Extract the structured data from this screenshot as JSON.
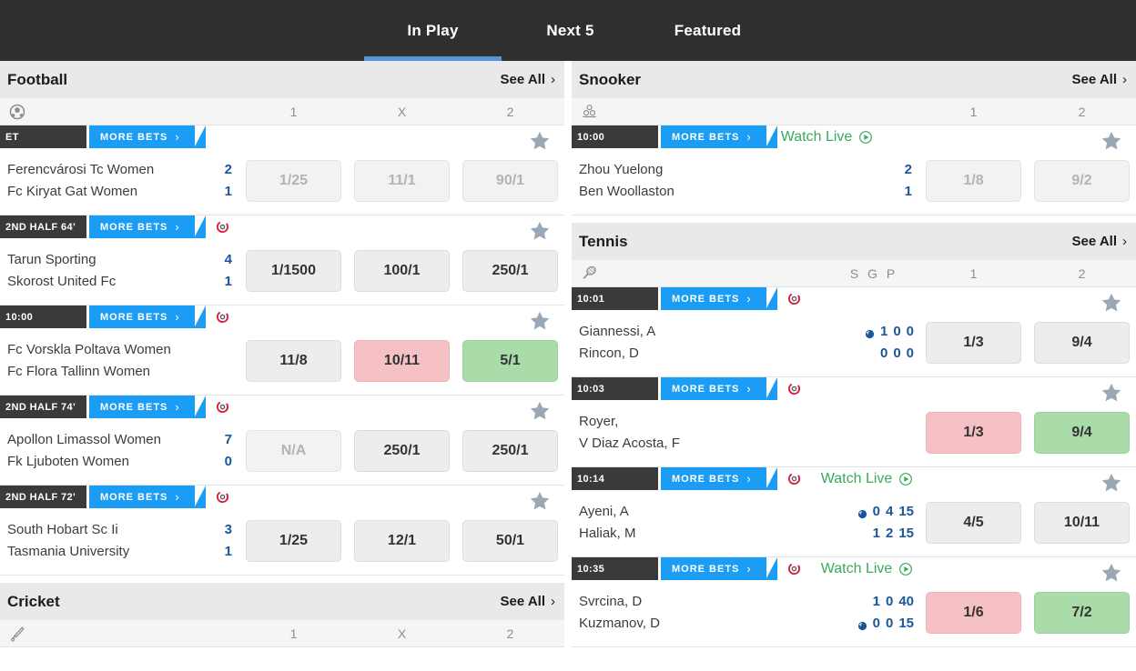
{
  "tabs": [
    {
      "label": "In Play",
      "active": true
    },
    {
      "label": "Next 5",
      "active": false
    },
    {
      "label": "Featured",
      "active": false
    }
  ],
  "labels": {
    "see_all": "See All",
    "chevron": "›",
    "more_bets": "MORE BETS",
    "more_bets_chevron": "›",
    "watch_live": "Watch Live"
  },
  "colors": {
    "accent_blue": "#1b9df5",
    "tab_underline": "#5596d8",
    "topbar_bg": "#2f2f2f",
    "time_chip_bg": "#3a3a3a",
    "score_blue": "#19569b",
    "watch_live_green": "#3aaa5c",
    "odds_up_green": "#aadcaa",
    "odds_down_pink": "#f6c1c5",
    "odds_neutral": "#ededed",
    "star_grey": "#9aa7b4",
    "stats_icon_red": "#d81f3f"
  },
  "left_column": [
    {
      "sport": "Football",
      "sport_icon": "football-icon",
      "columns": [
        "1",
        "X",
        "2"
      ],
      "events": [
        {
          "time": "ET",
          "has_stats": false,
          "watch_live": false,
          "teams": [
            "Ferencvárosi Tc Women",
            "Fc Kiryat Gat Women"
          ],
          "scores": [
            "2",
            "1"
          ],
          "odds": [
            {
              "value": "1/25",
              "state": "dim"
            },
            {
              "value": "11/1",
              "state": "dim"
            },
            {
              "value": "90/1",
              "state": "dim"
            }
          ]
        },
        {
          "time": "2ND HALF 64'",
          "has_stats": true,
          "watch_live": false,
          "teams": [
            "Tarun Sporting",
            "Skorost United Fc"
          ],
          "scores": [
            "4",
            "1"
          ],
          "odds": [
            {
              "value": "1/1500",
              "state": "neutral"
            },
            {
              "value": "100/1",
              "state": "neutral"
            },
            {
              "value": "250/1",
              "state": "neutral"
            }
          ]
        },
        {
          "time": "10:00",
          "has_stats": true,
          "watch_live": false,
          "teams": [
            "Fc Vorskla Poltava Women",
            "Fc Flora Tallinn Women"
          ],
          "scores": [
            "",
            ""
          ],
          "odds": [
            {
              "value": "11/8",
              "state": "neutral"
            },
            {
              "value": "10/11",
              "state": "down"
            },
            {
              "value": "5/1",
              "state": "up"
            }
          ]
        },
        {
          "time": "2ND HALF 74'",
          "has_stats": true,
          "watch_live": false,
          "teams": [
            "Apollon Limassol Women",
            "Fk Ljuboten Women"
          ],
          "scores": [
            "7",
            "0"
          ],
          "odds": [
            {
              "value": "N/A",
              "state": "dim"
            },
            {
              "value": "250/1",
              "state": "neutral"
            },
            {
              "value": "250/1",
              "state": "neutral"
            }
          ]
        },
        {
          "time": "2ND HALF 72'",
          "has_stats": true,
          "watch_live": false,
          "teams": [
            "South Hobart Sc Ii",
            "Tasmania University"
          ],
          "scores": [
            "3",
            "1"
          ],
          "odds": [
            {
              "value": "1/25",
              "state": "neutral"
            },
            {
              "value": "12/1",
              "state": "neutral"
            },
            {
              "value": "50/1",
              "state": "neutral"
            }
          ]
        }
      ]
    },
    {
      "sport": "Cricket",
      "sport_icon": "cricket-bat-icon",
      "columns": [
        "1",
        "X",
        "2"
      ],
      "events": []
    }
  ],
  "right_column": [
    {
      "sport": "Snooker",
      "sport_icon": "snooker-balls-icon",
      "columns": [
        "1",
        "2"
      ],
      "events": [
        {
          "time": "10:00",
          "has_stats": false,
          "watch_live": true,
          "teams": [
            "Zhou Yuelong",
            "Ben Woollaston"
          ],
          "scores": [
            "2",
            "1"
          ],
          "odds": [
            {
              "value": "1/8",
              "state": "dim"
            },
            {
              "value": "9/2",
              "state": "dim"
            }
          ]
        }
      ]
    },
    {
      "sport": "Tennis",
      "sport_icon": "tennis-racket-icon",
      "columns": [
        "S G P",
        "1",
        "2"
      ],
      "events": [
        {
          "time": "10:01",
          "has_stats": true,
          "watch_live": false,
          "teams": [
            "Giannessi, A",
            "Rincon, D"
          ],
          "tennis_scores": [
            {
              "serving": true,
              "values": [
                "1",
                "0",
                "0"
              ]
            },
            {
              "serving": false,
              "values": [
                "0",
                "0",
                "0"
              ]
            }
          ],
          "odds": [
            {
              "value": "1/3",
              "state": "neutral"
            },
            {
              "value": "9/4",
              "state": "neutral"
            }
          ]
        },
        {
          "time": "10:03",
          "has_stats": true,
          "watch_live": false,
          "teams": [
            "Royer,",
            "V Diaz Acosta, F"
          ],
          "tennis_scores": [],
          "odds": [
            {
              "value": "1/3",
              "state": "down"
            },
            {
              "value": "9/4",
              "state": "up"
            }
          ]
        },
        {
          "time": "10:14",
          "has_stats": true,
          "watch_live": true,
          "teams": [
            "Ayeni, A",
            "Haliak, M"
          ],
          "tennis_scores": [
            {
              "serving": true,
              "values": [
                "0",
                "4",
                "15"
              ]
            },
            {
              "serving": false,
              "values": [
                "1",
                "2",
                "15"
              ]
            }
          ],
          "odds": [
            {
              "value": "4/5",
              "state": "neutral"
            },
            {
              "value": "10/11",
              "state": "neutral"
            }
          ]
        },
        {
          "time": "10:35",
          "has_stats": true,
          "watch_live": true,
          "teams": [
            "Svrcina, D",
            "Kuzmanov, D"
          ],
          "tennis_scores": [
            {
              "serving": false,
              "values": [
                "1",
                "0",
                "40"
              ]
            },
            {
              "serving": true,
              "values": [
                "0",
                "0",
                "15"
              ]
            }
          ],
          "odds": [
            {
              "value": "1/6",
              "state": "down"
            },
            {
              "value": "7/2",
              "state": "up"
            }
          ]
        }
      ]
    }
  ]
}
